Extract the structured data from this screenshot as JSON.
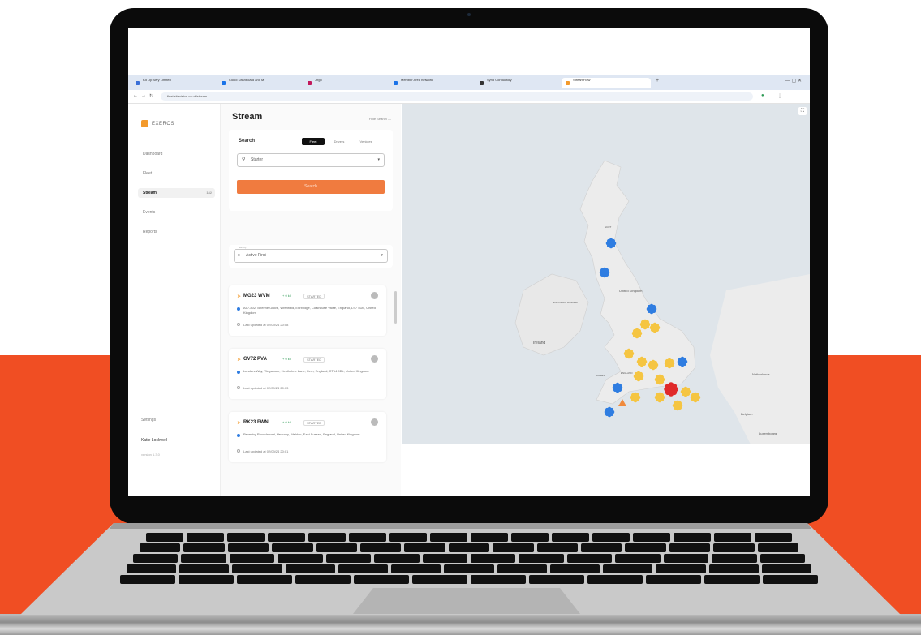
{
  "browser": {
    "tabs": [
      {
        "label": "Kd Op Sery Limited",
        "color": "#3a6fd8"
      },
      {
        "label": "Cloud Dashboard and M",
        "color": "#1a73e8"
      },
      {
        "label": "Jngo",
        "color": "#c2185b"
      },
      {
        "label": "Member Area network",
        "color": "#1a73e8"
      },
      {
        "label": "Syn3 Conductory",
        "color": "#333333"
      },
      {
        "label": "StreamFlow",
        "color": "#f39a2c"
      }
    ],
    "url": "fleet.sitevision.co.uk/stream"
  },
  "sidebar": {
    "logo": "EXEROS",
    "items": [
      {
        "label": "Dashboard"
      },
      {
        "label": "Fleet"
      },
      {
        "label": "Stream",
        "count": "182"
      },
      {
        "label": "Events"
      },
      {
        "label": "Reports"
      }
    ],
    "settings": "Settings",
    "user": "Katie Lockwell",
    "version": "version 1.3.0"
  },
  "stream": {
    "title": "Stream",
    "hide_label": "Hide Search —",
    "search_label": "Search",
    "segments": [
      "Fleet",
      "Drivers",
      "Vehicles"
    ],
    "input_value": "Starter",
    "search_button": "Search",
    "sort_caption": "Sort by",
    "sort_value": "Active First",
    "vehicles": [
      {
        "plate": "MG23 WVM",
        "speed": "+ 0 kl",
        "state": "STARTED",
        "address": "A57-802, Brienne Grove, Wrenfield, Enrbridge, Coalhouse Vaise, England, LS7 5DB, United Kingdom",
        "updated": "Last updated at 02/09/24 20:08"
      },
      {
        "plate": "GV72 PVA",
        "speed": "+ 0 kl",
        "state": "STARTED",
        "address": "Landers Way, Wegsmoor, Hestholme Lane, Kern, England, CT14 9DL, United Kingdom",
        "updated": "Last updated at 02/09/24 20:03"
      },
      {
        "plate": "RK23 FWN",
        "speed": "+ 0 kl",
        "state": "STARTED",
        "address": "Peventry Roundabout, Hearney, Weldon, East Sussex, England, United Kingdom",
        "updated": "Last updated at 02/09/24 20:01"
      }
    ]
  },
  "map": {
    "labels": {
      "uk": "United Kingdom",
      "ireland": "Ireland",
      "ni": "NORTHERN IRELAND",
      "wales": "WALES",
      "england": "ENGLAND",
      "netherlands": "Netherlands",
      "belgium": "Belgium",
      "luxembourg": "Luxembourg",
      "scotland": "SCOT"
    }
  },
  "colors": {
    "accent": "#f04e23",
    "marker_blue": "#2f7de1",
    "marker_yellow": "#f5c542",
    "marker_red": "#e02a2a"
  }
}
